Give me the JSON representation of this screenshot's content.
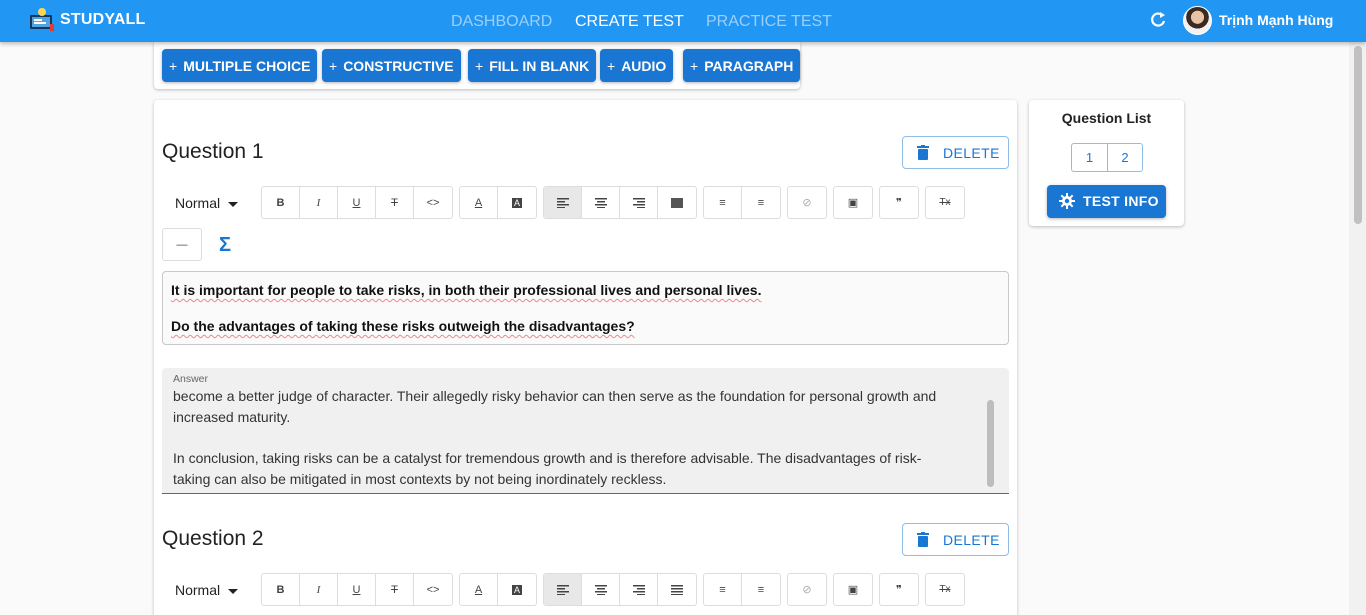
{
  "app": {
    "name": "STUDYALL"
  },
  "nav": {
    "dashboard": "DASHBOARD",
    "create_test": "CREATE TEST",
    "practice_test": "PRACTICE TEST"
  },
  "user": {
    "name": "Trịnh Mạnh Hùng"
  },
  "add_buttons": {
    "plus": "+",
    "multiple_choice": "MULTIPLE CHOICE",
    "constructive": "CONSTRUCTIVE",
    "fill_in_blank": "FILL IN BLANK",
    "audio": "AUDIO",
    "paragraph": "PARAGRAPH"
  },
  "questions": [
    {
      "title": "Question 1",
      "delete_label": "DELETE",
      "format_select": "Normal",
      "prompt_lines": [
        "It is important for people to take risks, in both their professional lives and personal lives.",
        "Do the advantages of taking these risks outweigh the disadvantages?"
      ],
      "answer_label": "Answer",
      "answer_lines": [
        "become a better judge of character. Their allegedly risky behavior can then serve as the foundation for personal growth and",
        "increased maturity.",
        "In conclusion, taking risks can be a catalyst for tremendous growth and is therefore advisable. The disadvantages of risk-",
        "taking can also be mitigated in most contexts by not being inordinately reckless."
      ]
    },
    {
      "title": "Question 2",
      "delete_label": "DELETE",
      "format_select": "Normal"
    }
  ],
  "toolbar_glyphs": {
    "bold": "B",
    "italic": "I",
    "underline": "U",
    "strike": "T",
    "code": "<>",
    "color": "A",
    "background": "A",
    "list_bullet": "≡",
    "list_ordered": "≡",
    "link": "⊘",
    "image": "▣",
    "quote": "❞",
    "clean": "Tx",
    "divider": "—",
    "formula": "Σ"
  },
  "question_list": {
    "title": "Question List",
    "items": [
      "1",
      "2"
    ]
  },
  "test_info": {
    "label": "TEST INFO"
  },
  "colors": {
    "appbar": "#2196f3",
    "primary": "#1976d2"
  }
}
